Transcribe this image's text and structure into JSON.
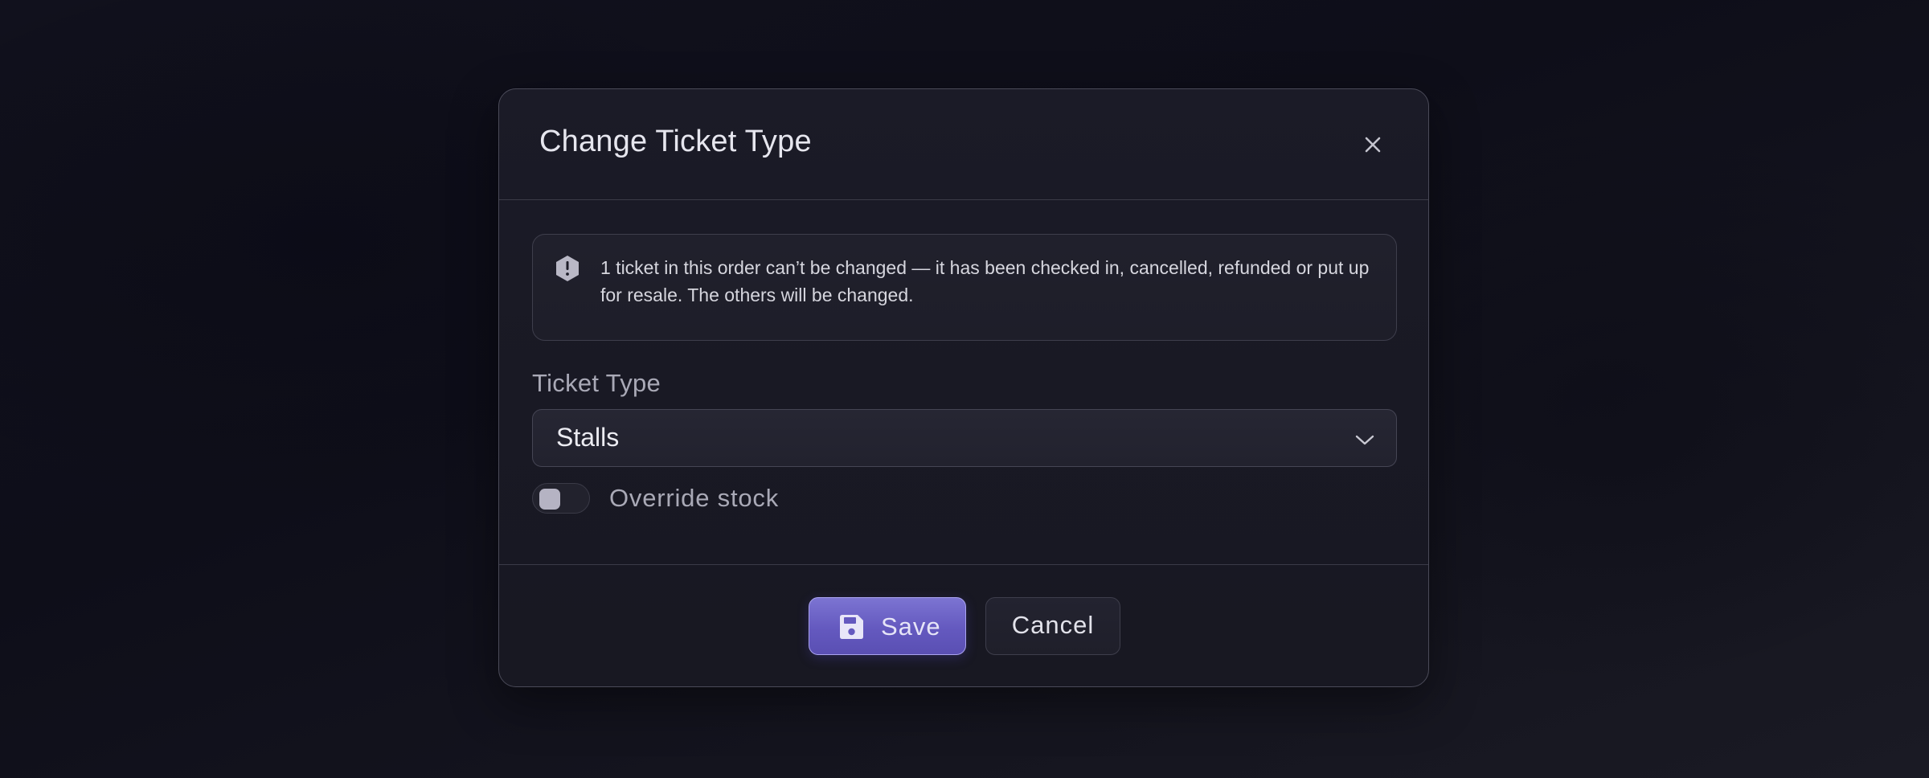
{
  "modal": {
    "title": "Change Ticket Type",
    "close_icon": "close-icon"
  },
  "alert": {
    "icon": "warning-hexagon-icon",
    "message": "1 ticket in this order can’t be changed — it has been checked in, cancelled, refunded or put up for resale. The others will be changed."
  },
  "ticket_type": {
    "label": "Ticket Type",
    "selected": "Stalls",
    "icon": "chevron-down-icon"
  },
  "override_stock": {
    "label": "Override stock",
    "enabled": false
  },
  "footer": {
    "save_label": "Save",
    "save_icon": "floppy-disk-icon",
    "cancel_label": "Cancel"
  },
  "colors": {
    "accent": "#6459bf",
    "accent_border": "#a9a2ee",
    "background": "#121220",
    "modal_background": "#1a1a25"
  }
}
